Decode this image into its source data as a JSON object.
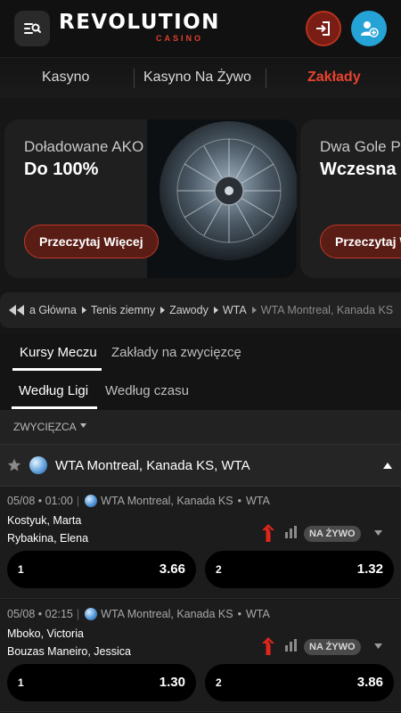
{
  "header": {
    "logo_main": "REVOLUTION",
    "logo_sub": "CASINO"
  },
  "nav": {
    "items": [
      {
        "label": "Kasyno"
      },
      {
        "label": "Kasyno Na Żywo"
      },
      {
        "label": "Zakłady"
      }
    ]
  },
  "promos": [
    {
      "eyebrow": "Doładowane AKO",
      "title": "Do 100%",
      "button": "Przeczytaj Więcej"
    },
    {
      "eyebrow": "Dwa Gole Pr",
      "title": "Wczesna W",
      "button": "Przeczytaj W"
    }
  ],
  "breadcrumb": [
    "a Główna",
    "Tenis ziemny",
    "Zawody",
    "WTA",
    "WTA Montreal, Kanada KS"
  ],
  "tabs": {
    "primary": [
      "Kursy Meczu",
      "Zakłady na zwycięzcę"
    ],
    "secondary": [
      "Według Ligi",
      "Według czasu"
    ]
  },
  "filter": {
    "label": "ZWYCIĘZCA"
  },
  "league": {
    "title": "WTA Montreal, Kanada KS, WTA"
  },
  "matches": [
    {
      "datetime": "05/08 • 01:00",
      "competition": "WTA Montreal, Kanada KS",
      "tour": "WTA",
      "home": "Kostyuk, Marta",
      "away": "Rybakina, Elena",
      "live_label": "NA ŻYWO",
      "odds": [
        {
          "label": "1",
          "value": "3.66"
        },
        {
          "label": "2",
          "value": "1.32"
        }
      ]
    },
    {
      "datetime": "05/08 • 02:15",
      "competition": "WTA Montreal, Kanada KS",
      "tour": "WTA",
      "home": "Mboko, Victoria",
      "away": "Bouzas Maneiro, Jessica",
      "live_label": "NA ŻYWO",
      "odds": [
        {
          "label": "1",
          "value": "1.30"
        },
        {
          "label": "2",
          "value": "3.86"
        }
      ]
    }
  ],
  "colors": {
    "accent": "#e6432e",
    "register": "#25a3d6",
    "login": "#7a1d14"
  }
}
